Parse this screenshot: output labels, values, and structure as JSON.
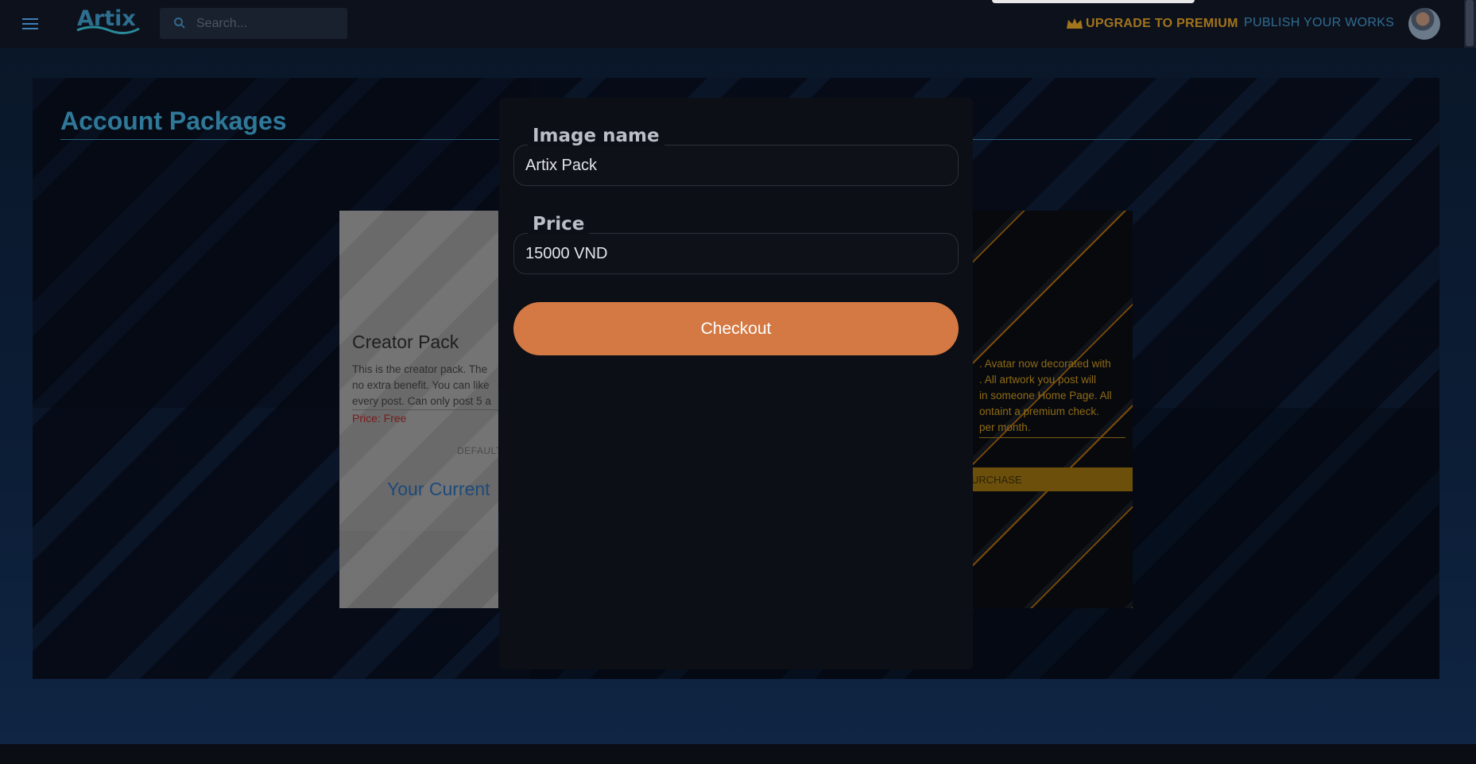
{
  "topbar": {
    "logo_text": "Artix",
    "search_placeholder": "Search...",
    "upgrade_label": "UPGRADE TO PREMIUM",
    "publish_label": "PUBLISH YOUR WORKS"
  },
  "page": {
    "title": "Account Packages"
  },
  "cards": {
    "creator": {
      "title": "Creator Pack",
      "description": "This is the creator pack. The\nno extra benefit. You can like\nevery post. Can only post 5 a",
      "price": "Price: Free",
      "status": "DEFAULT",
      "current_label": "Your Current"
    },
    "premium": {
      "description": ". Avatar now decorated with\n. All artwork you post will\n in someone Home Page. All\nontaint a premium check.\n per month.",
      "button_label": "URCHASE"
    }
  },
  "modal": {
    "image_name_label": "Image name",
    "image_name_value": "Artix Pack",
    "price_label": "Price",
    "price_value": "15000 VND",
    "checkout_label": "Checkout"
  },
  "colors": {
    "accent": "#d47943",
    "premium_gold": "#a2741c",
    "link_blue": "#2f6d92",
    "modal_bg": "#0c0f15"
  },
  "icons": [
    "menu-icon",
    "search-icon",
    "crown-icon",
    "avatar"
  ]
}
